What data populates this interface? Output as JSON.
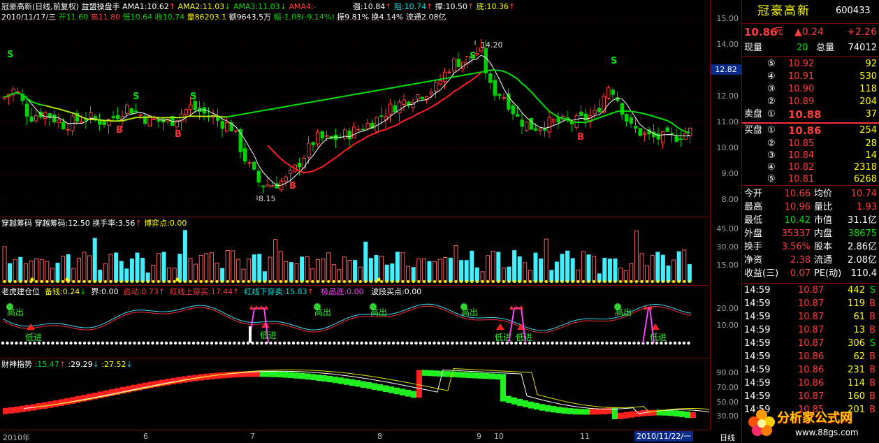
{
  "main_header": {
    "title": "冠豪高新(日线,前复权) 益盟操盘手",
    "ama1": "AMA1:10.62",
    "ama2": "AMA2:11.03",
    "ama3": "AMA3:11.03",
    "ama4": "AMA4:-",
    "strong": "强:10.84",
    "resist": "阻:10.74",
    "support": "撑:10.50",
    "bottom": "底:10.36",
    "line2_date": "2010/11/17/三",
    "line2_open": "开11.60",
    "line2_high": "高11.80",
    "line2_low": "低10.64",
    "line2_close": "收10.74",
    "line2_vol": "量86203.1",
    "line2_amt": "额9643.5万",
    "line2_chg": "幅-1.08(-9.14%)",
    "line2_amp": "振9.81%",
    "line2_turn": "换4.14%",
    "line2_float": "流通2.08亿",
    "annot_high": "14.20",
    "annot_low": "8.15",
    "price_marker": "12.82"
  },
  "main_axis": [
    "15.00",
    "14.00",
    "13.00",
    "12.00",
    "11.00",
    "10.00",
    "9.00",
    "8.00"
  ],
  "panel2": {
    "name": "穿越筹码",
    "v1": "穿越筹码:12.50",
    "v2": "换手率:3.56",
    "v3": "博弈点:0.00",
    "axis": [
      "45.00",
      "30.00",
      "15.00"
    ]
  },
  "panel3": {
    "name": "老虎建仓位",
    "v1": "备钱:0.24",
    "v2": "界:0.00",
    "v3": "启动:0.73",
    "v4": "红线上穿买:17.44",
    "v5": "红线下穿卖:15.83",
    "v6": "极品底:0.00",
    "v7": "波段买点:0.00",
    "axis": [
      "20.00",
      "10.00"
    ],
    "label_out": "高出",
    "label_in": "低进"
  },
  "panel4": {
    "name": "财神指势",
    "v1": ":15.47",
    "v2": ":29.29",
    "v3": ":27.52",
    "axis": [
      "90.00",
      "70.00",
      "50.00",
      "30.00"
    ]
  },
  "bottom_axis": {
    "labels": [
      "2010年",
      "6",
      "7",
      "8",
      "9",
      "10",
      "11"
    ],
    "date_box": "2010/11/22/一",
    "period": "日线"
  },
  "signals": {
    "sell": "S",
    "buy": "B"
  },
  "quote": {
    "name": "冠豪高新",
    "code": "600433",
    "price": "10.86",
    "price_unit": "元",
    "change": "▲0.24",
    "pct": "+2.26",
    "now_label": "现量",
    "now_vol": "20",
    "total_label": "总量",
    "total_vol": "74012",
    "asks": [
      {
        "lv": "⑤",
        "p": "10.92",
        "v": "92"
      },
      {
        "lv": "④",
        "p": "10.91",
        "v": "530"
      },
      {
        "lv": "③",
        "p": "10.90",
        "v": "118"
      },
      {
        "lv": "②",
        "p": "10.89",
        "v": "204"
      }
    ],
    "ask1": {
      "label": "卖盘",
      "lv": "①",
      "p": "10.88",
      "v": "37"
    },
    "bid1": {
      "label": "买盘",
      "lv": "①",
      "p": "10.86",
      "v": "254"
    },
    "bids": [
      {
        "lv": "②",
        "p": "10.85",
        "v": "28"
      },
      {
        "lv": "③",
        "p": "10.84",
        "v": "14"
      },
      {
        "lv": "④",
        "p": "10.82",
        "v": "2318"
      },
      {
        "lv": "⑤",
        "p": "10.81",
        "v": "6268"
      }
    ],
    "stats": [
      {
        "a": "今开",
        "av": "10.66",
        "b": "均价",
        "bv": "10.74"
      },
      {
        "a": "最高",
        "av": "10.96",
        "b": "量比",
        "bv": "1.93"
      },
      {
        "a": "最低",
        "av": "10.42",
        "b": "市值",
        "bv": "31.1亿"
      },
      {
        "a": "外盘",
        "av": "35337",
        "b": "内盘",
        "bv": "38675"
      },
      {
        "a": "换手",
        "av": "3.56%",
        "b": "股本",
        "bv": "2.86亿"
      },
      {
        "a": "净资",
        "av": "2.38",
        "b": "流通",
        "bv": "2.08亿"
      },
      {
        "a": "收益(三)",
        "av": "0.07",
        "b": "PE(动)",
        "bv": "110.4"
      }
    ],
    "ticks": [
      {
        "t": "14:59",
        "p": "10.87",
        "v": "442",
        "s": "S"
      },
      {
        "t": "14:59",
        "p": "10.87",
        "v": "119",
        "s": "B"
      },
      {
        "t": "14:59",
        "p": "10.87",
        "v": "61",
        "s": "B"
      },
      {
        "t": "14:59",
        "p": "10.87",
        "v": "13",
        "s": "B"
      },
      {
        "t": "14:59",
        "p": "10.87",
        "v": "306",
        "s": "S"
      },
      {
        "t": "14:59",
        "p": "10.86",
        "v": "62",
        "s": "B"
      },
      {
        "t": "14:59",
        "p": "10.86",
        "v": "231",
        "s": "B"
      },
      {
        "t": "14:59",
        "p": "10.86",
        "v": "114",
        "s": "B"
      },
      {
        "t": "14:59",
        "p": "10.87",
        "v": "160",
        "s": "B"
      },
      {
        "t": "14:59",
        "p": "10.85",
        "v": "201",
        "s": "B"
      }
    ]
  },
  "watermark": {
    "text": "分析家公式网",
    "url": "www.88gs.com"
  }
}
